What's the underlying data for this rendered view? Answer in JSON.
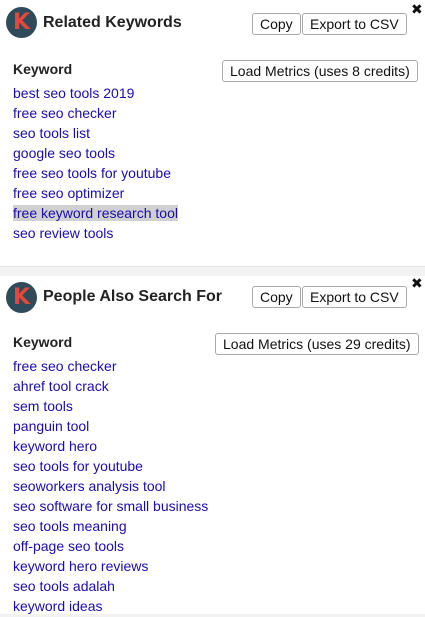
{
  "panels": [
    {
      "logo_letter": "K",
      "title": "Related Keywords",
      "copy_label": "Copy",
      "export_label": "Export to CSV",
      "close_glyph": "✖",
      "column_header": "Keyword",
      "load_metrics_label": "Load Metrics (uses 8 credits)",
      "keywords": [
        "best seo tools 2019",
        "free seo checker",
        "seo tools list",
        "google seo tools",
        "free seo tools for youtube",
        "free seo optimizer",
        "free keyword research tool",
        "seo review tools"
      ],
      "highlighted_keyword_index": 6
    },
    {
      "logo_letter": "K",
      "title": "People Also Search For",
      "copy_label": "Copy",
      "export_label": "Export to CSV",
      "close_glyph": "✖",
      "column_header": "Keyword",
      "load_metrics_label": "Load Metrics (uses 29 credits)",
      "keywords": [
        "free seo checker",
        "ahref tool crack",
        "sem tools",
        "panguin tool",
        "keyword hero",
        "seo tools for youtube",
        "seoworkers analysis tool",
        "seo software for small business",
        "seo tools meaning",
        "off-page seo tools",
        "keyword hero reviews",
        "seo tools adalah",
        "keyword ideas"
      ]
    }
  ],
  "colors": {
    "link": "#1a0dab",
    "logo_bg": "#2f4a5a",
    "logo_letter": "#e04a3a",
    "highlight": "#d0d0d0"
  }
}
